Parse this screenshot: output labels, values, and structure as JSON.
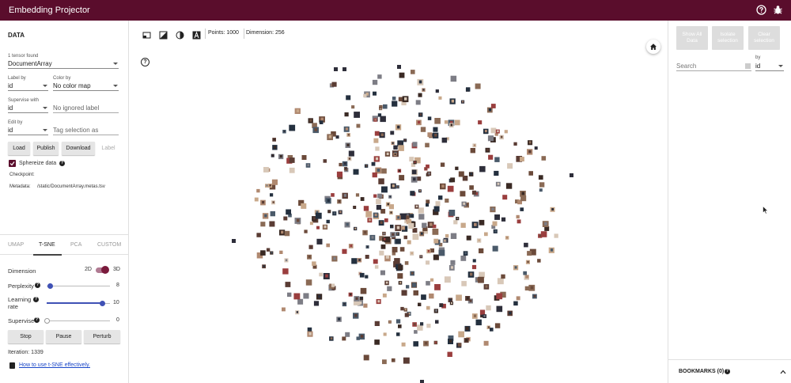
{
  "app": {
    "title": "Embedding Projector",
    "icons": [
      "help-icon",
      "settings-icon"
    ]
  },
  "data_panel": {
    "section_title": "DATA",
    "tensor_label": "1 tensor found",
    "tensor_value": "DocumentArray",
    "label_by": {
      "label": "Label by",
      "value": "id"
    },
    "color_map": {
      "label": "Color by",
      "value": "No color map"
    },
    "supervise_with": {
      "label": "Supervise with",
      "value": "id"
    },
    "ignored_label": {
      "placeholder": "No ignored label"
    },
    "edit_by": {
      "label": "Edit by",
      "value": "id"
    },
    "tag_selection": {
      "placeholder": "Tag selection as"
    },
    "buttons": {
      "load": "Load",
      "publish": "Publish",
      "download": "Download",
      "label": "Label"
    },
    "sphereize": {
      "label": "Sphereize data",
      "checked": true
    },
    "checkpoint": {
      "label": "Checkpoint:",
      "value": ""
    },
    "metadata": {
      "label": "Metadata:",
      "value": "/static/DocumentArray.metas.tsv"
    }
  },
  "projection": {
    "tabs": [
      "UMAP",
      "T-SNE",
      "PCA",
      "CUSTOM"
    ],
    "active_tab": "T-SNE",
    "dimension": {
      "label": "Dimension",
      "option_2d": "2D",
      "option_3d": "3D",
      "selected": "3D"
    },
    "perplexity": {
      "label": "Perplexity",
      "value": "8",
      "fraction": 0.05
    },
    "learning_rate": {
      "label": "Learning rate",
      "value": "10",
      "fraction": 0.88
    },
    "supervise": {
      "label": "Supervise",
      "value": "0",
      "fraction": 0.0
    },
    "buttons": {
      "stop": "Stop",
      "pause": "Pause",
      "perturb": "Perturb"
    },
    "iteration": "Iteration: 1339",
    "help_link": "How to use t-SNE effectively."
  },
  "toolbar": {
    "points": "Points: 1000",
    "dimension": "Dimension: 256",
    "icons": [
      "select-rectangle-icon",
      "night-mode-icon",
      "contrast-icon",
      "label-icon"
    ]
  },
  "inspector": {
    "buttons": {
      "show_all": "Show All Data",
      "isolate": "Isolate selection",
      "clear": "Clear selection"
    },
    "search": {
      "placeholder": "Search"
    },
    "by": {
      "label": "by",
      "value": "id"
    },
    "bookmarks": "BOOKMARKS (0)"
  },
  "scatter": {
    "point_count": 1000,
    "colors": [
      "#3a2a24",
      "#6b4a3a",
      "#8a6a55",
      "#2e2e3a",
      "#b08970",
      "#5a3c34",
      "#7d7d85",
      "#c8a88a",
      "#24303f",
      "#9a3e3e",
      "#4a5a6a",
      "#d8c8b8"
    ]
  }
}
